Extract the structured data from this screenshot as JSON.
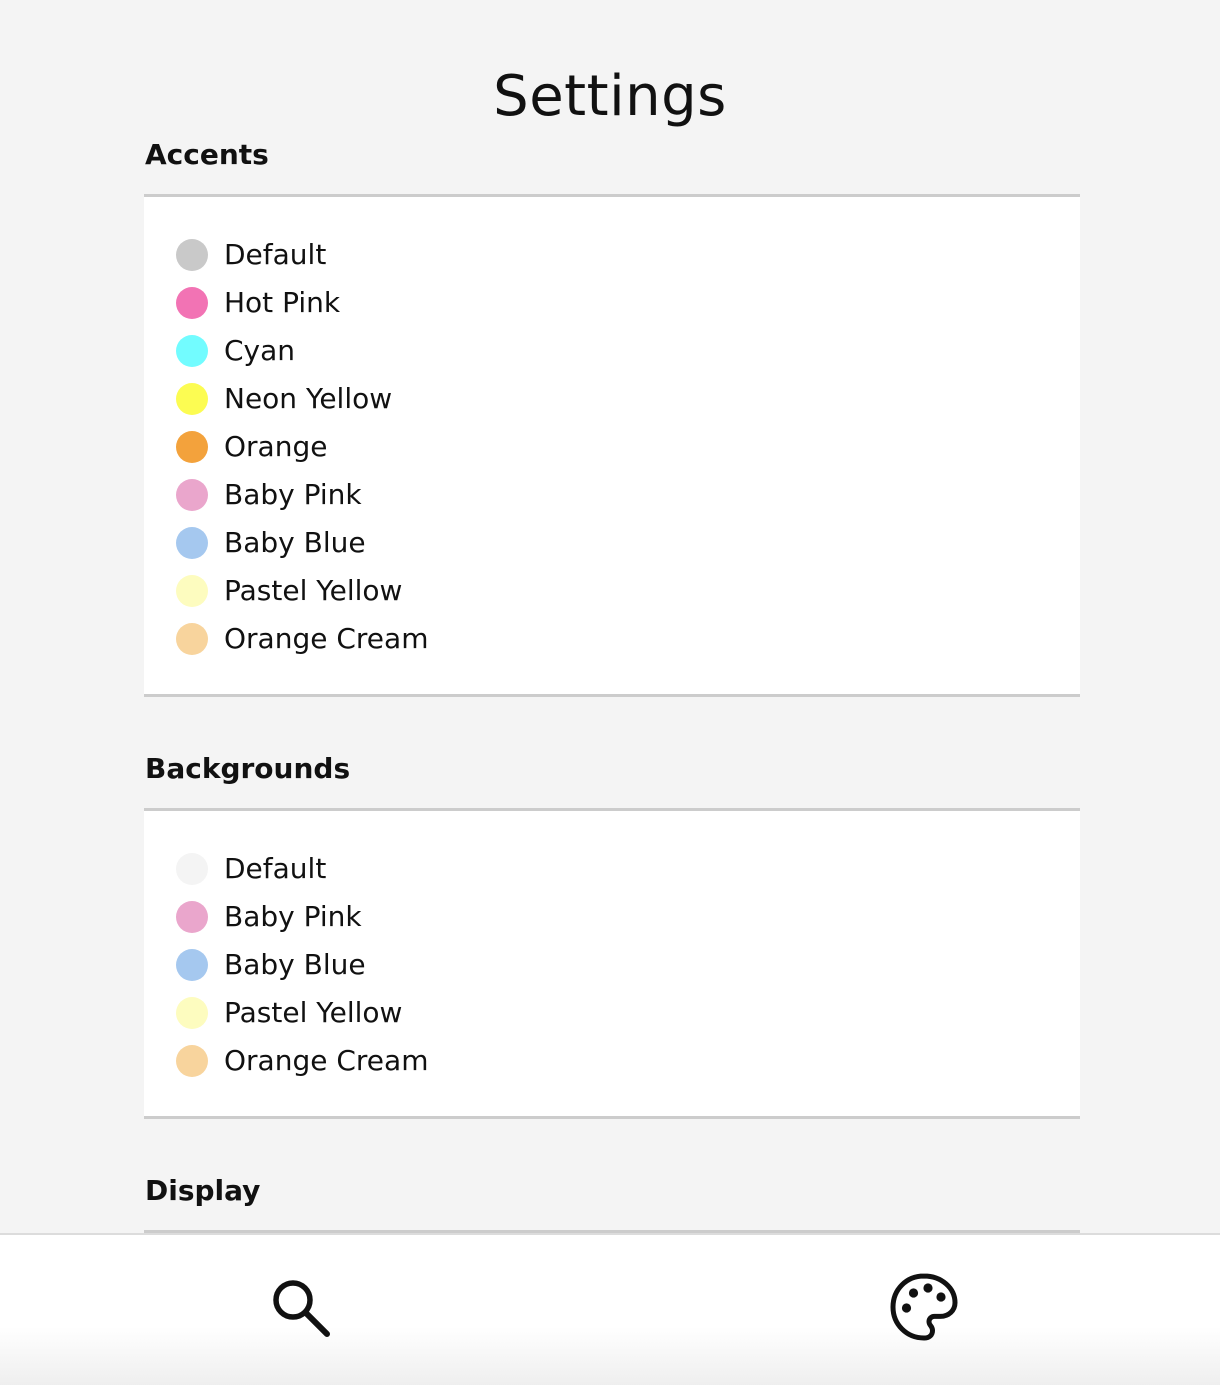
{
  "page": {
    "title": "Settings"
  },
  "accents": {
    "heading": "Accents",
    "items": [
      {
        "label": "Default",
        "color": "#c9c9c9"
      },
      {
        "label": "Hot Pink",
        "color": "#f273b4"
      },
      {
        "label": "Cyan",
        "color": "#72fcff"
      },
      {
        "label": "Neon Yellow",
        "color": "#fcfc52"
      },
      {
        "label": "Orange",
        "color": "#f3a23c"
      },
      {
        "label": "Baby Pink",
        "color": "#eaa6cc"
      },
      {
        "label": "Baby Blue",
        "color": "#a5c8ef"
      },
      {
        "label": "Pastel Yellow",
        "color": "#fdfcbf"
      },
      {
        "label": "Orange Cream",
        "color": "#f8d49d"
      }
    ]
  },
  "backgrounds": {
    "heading": "Backgrounds",
    "items": [
      {
        "label": "Default",
        "color": "#f4f4f4"
      },
      {
        "label": "Baby Pink",
        "color": "#eaa6cc"
      },
      {
        "label": "Baby Blue",
        "color": "#a5c8ef"
      },
      {
        "label": "Pastel Yellow",
        "color": "#fdfcbf"
      },
      {
        "label": "Orange Cream",
        "color": "#f8d49d"
      }
    ]
  },
  "display": {
    "heading": "Display"
  },
  "bottom_nav": {
    "left_icon": "search-icon",
    "right_icon": "palette-icon"
  }
}
